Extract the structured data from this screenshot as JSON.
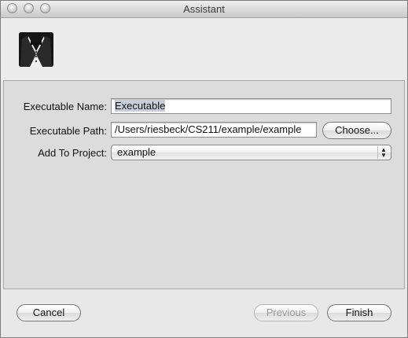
{
  "window": {
    "title": "Assistant"
  },
  "form": {
    "executable_name": {
      "label": "Executable Name:",
      "value": "Executable"
    },
    "executable_path": {
      "label": "Executable Path:",
      "value": "/Users/riesbeck/CS211/example/example"
    },
    "add_to_project": {
      "label": "Add To Project:",
      "value": "example"
    },
    "choose_label": "Choose..."
  },
  "buttons": {
    "cancel": "Cancel",
    "previous": "Previous",
    "finish": "Finish"
  },
  "colors": {
    "selection": "#c7d0da",
    "panel": "#dcdcdc"
  },
  "icons": {
    "logo": "tuxedo-icon"
  }
}
